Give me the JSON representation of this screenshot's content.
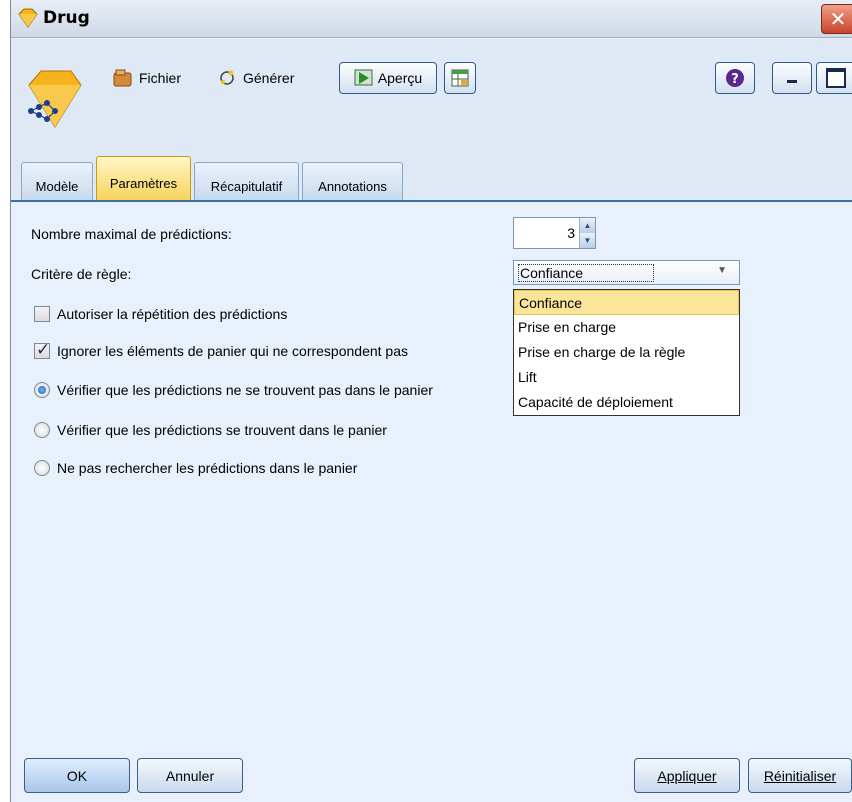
{
  "window": {
    "title": "Drug",
    "close_symbol": "✕"
  },
  "toolbar": {
    "fichier_label": "Fichier",
    "generer_label": "Générer",
    "apercu_label": "Aperçu"
  },
  "tabs": [
    {
      "label": "Modèle"
    },
    {
      "label": "Paramètres"
    },
    {
      "label": "Récapitulatif"
    },
    {
      "label": "Annotations"
    }
  ],
  "settings": {
    "max_predictions_label": "Nombre maximal de prédictions:",
    "max_predictions_value": "3",
    "rule_criterion_label": "Critère de règle:",
    "rule_criterion_value": "Confiance",
    "rule_criterion_options": [
      "Confiance",
      "Prise en charge",
      "Prise en charge de la règle",
      "Lift",
      "Capacité de déploiement"
    ],
    "allow_repeat_label": "Autoriser la répétition des prédictions",
    "allow_repeat_checked": false,
    "ignore_unmatched_label": "Ignorer les éléments de panier qui ne correspondent pas",
    "ignore_unmatched_checked": true,
    "radio_options": [
      "Vérifier que les prédictions ne se trouvent pas dans le panier",
      "Vérifier que les prédictions se trouvent dans le panier",
      "Ne pas rechercher les prédictions dans le panier"
    ],
    "radio_selected_index": 0
  },
  "footer": {
    "ok_label": "OK",
    "cancel_label": "Annuler",
    "apply_label": "Appliquer",
    "reset_label": "Réinitialiser"
  },
  "colors": {
    "panel_bg": "#e8f1fb",
    "active_tab": "#f9d45a",
    "selected_option": "#fbe59a"
  }
}
